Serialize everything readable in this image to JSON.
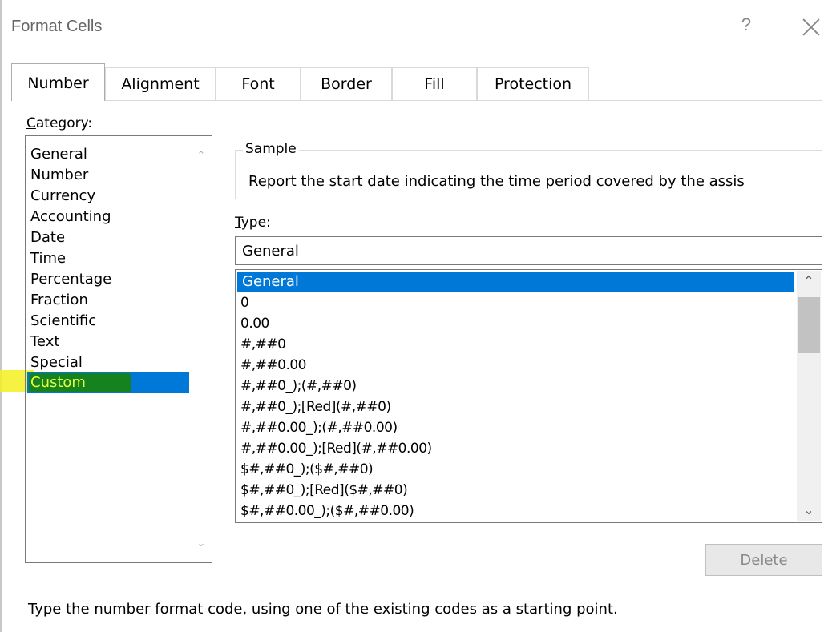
{
  "dialog": {
    "title": "Format Cells",
    "help_label": "?"
  },
  "tabs": [
    {
      "label": "Number",
      "active": true
    },
    {
      "label": "Alignment",
      "active": false
    },
    {
      "label": "Font",
      "active": false
    },
    {
      "label": "Border",
      "active": false
    },
    {
      "label": "Fill",
      "active": false
    },
    {
      "label": "Protection",
      "active": false
    }
  ],
  "category": {
    "label_first": "C",
    "label_rest": "ategory:",
    "items": [
      "General",
      "Number",
      "Currency",
      "Accounting",
      "Date",
      "Time",
      "Percentage",
      "Fraction",
      "Scientific",
      "Text",
      "Special",
      "Custom"
    ],
    "selected": "Custom"
  },
  "sample": {
    "label": "Sample",
    "text": "Report the start date indicating the time period covered by the assis"
  },
  "type": {
    "label_first": "T",
    "label_rest": "ype:",
    "value": "General",
    "items": [
      "General",
      "0",
      "0.00",
      "#,##0",
      "#,##0.00",
      "#,##0_);(#,##0)",
      "#,##0_);[Red](#,##0)",
      "#,##0.00_);(#,##0.00)",
      "#,##0.00_);[Red](#,##0.00)",
      "$#,##0_);($#,##0)",
      "$#,##0_);[Red]($#,##0)",
      "$#,##0.00_);($#,##0.00)"
    ],
    "selected": "General"
  },
  "buttons": {
    "delete": "Delete"
  },
  "hint": "Type the number format code, using one of the existing codes as a starting point.",
  "colors": {
    "selection": "#0078d7",
    "highlight_yellow": "#f5f020",
    "highlight_green": "#15811f"
  }
}
